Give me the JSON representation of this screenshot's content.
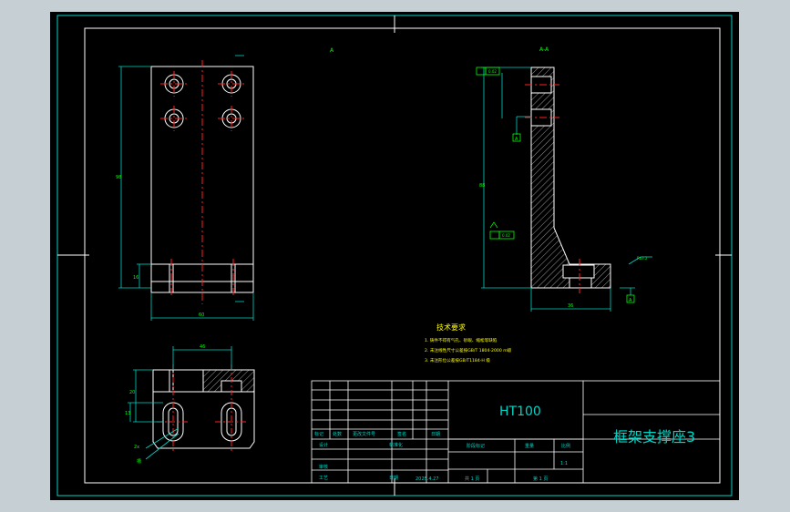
{
  "drawing": {
    "material": "HT100",
    "part_name": "框架支撑座3",
    "scale": "1:1",
    "sheet_info": "共 1 页",
    "sheet_no": "第 1 页",
    "date": "2025.4.27",
    "section_mark_a": "A",
    "section_mark_view": "A-A"
  },
  "title_block": {
    "labels": {
      "mark": "标记",
      "count": "处数",
      "zone": "更改文件号",
      "sign": "签名",
      "date": "日期",
      "design": "设计",
      "standard": "标准化",
      "stage": "阶段标记",
      "weight": "重量",
      "ratio": "比例",
      "review": "审核",
      "craft": "工艺",
      "approve": "日期"
    }
  },
  "tech_req": {
    "title": "技术要求",
    "lines": [
      "1. 铸件不得有气孔、砂眼、缩松等缺陷",
      "2. 未注线性尺寸公差按GB/T 1804-2000 m级",
      "3. 未注形位公差按GB/T1184-H 级"
    ]
  },
  "dimensions": {
    "front_height": "98",
    "front_width": "60",
    "front_small": "16",
    "side_height": "88",
    "side_width": "36",
    "bottom_width": "46",
    "bottom_left_a": "20",
    "bottom_left_b": "13",
    "bottom_hole": "2x",
    "bottom_slot": "槽",
    "tol_left": "0.02",
    "tol_right": "0.02",
    "datum": "A",
    "rough": "Ra3.2"
  },
  "colors": {
    "frame": "#00d5c6",
    "outline": "#ffffff",
    "center": "#ff2020",
    "dim": "#00ff00",
    "tech": "#ffff00",
    "tol": "#00ff00"
  }
}
